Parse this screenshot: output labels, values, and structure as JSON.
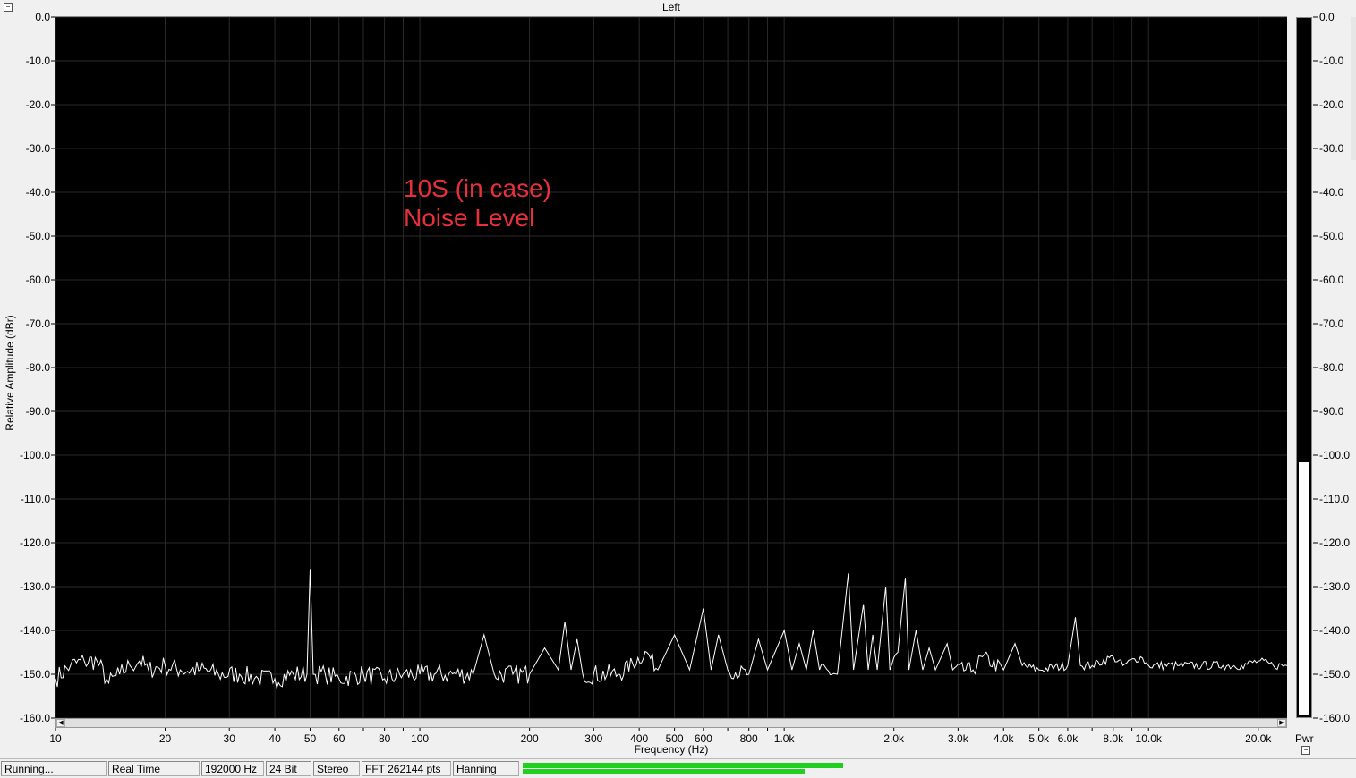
{
  "window": {
    "title": "Left"
  },
  "annotation": {
    "line1": "10S (in case)",
    "line2": "Noise Level"
  },
  "meter": {
    "label": "Pwr",
    "level_db": -102.0
  },
  "status": {
    "state": "Running...",
    "mode": "Real Time",
    "sample_rate": "192000 Hz",
    "bit_depth": "24 Bit",
    "channels": "Stereo",
    "fft": "FFT 262144 pts",
    "window": "Hanning",
    "progress_fraction": 0.56
  },
  "colors": {
    "plot_bg": "#000000",
    "trace": "#ffffff",
    "grid": "#2a2a2a",
    "annotation": "#e8303a",
    "progress": "#20d020"
  },
  "chart_data": {
    "type": "line",
    "xlabel": "Frequency (Hz)",
    "ylabel": "Relative Amplitude (dBr)",
    "xscale": "log",
    "xlim": [
      10,
      24000
    ],
    "ylim": [
      -160,
      0
    ],
    "x_ticks": [
      {
        "v": 10,
        "label": "10"
      },
      {
        "v": 20,
        "label": "20"
      },
      {
        "v": 30,
        "label": "30"
      },
      {
        "v": 40,
        "label": "40"
      },
      {
        "v": 50,
        "label": "50"
      },
      {
        "v": 60,
        "label": "60"
      },
      {
        "v": 80,
        "label": "80"
      },
      {
        "v": 100,
        "label": "100"
      },
      {
        "v": 200,
        "label": "200"
      },
      {
        "v": 300,
        "label": "300"
      },
      {
        "v": 400,
        "label": "400"
      },
      {
        "v": 500,
        "label": "500"
      },
      {
        "v": 600,
        "label": "600"
      },
      {
        "v": 800,
        "label": "800"
      },
      {
        "v": 1000,
        "label": "1.0k"
      },
      {
        "v": 2000,
        "label": "2.0k"
      },
      {
        "v": 3000,
        "label": "3.0k"
      },
      {
        "v": 4000,
        "label": "4.0k"
      },
      {
        "v": 5000,
        "label": "5.0k"
      },
      {
        "v": 6000,
        "label": "6.0k"
      },
      {
        "v": 8000,
        "label": "8.0k"
      },
      {
        "v": 10000,
        "label": "10.0k"
      },
      {
        "v": 20000,
        "label": "20.0k"
      }
    ],
    "y_ticks": [
      "0.0",
      "-10.0",
      "-20.0",
      "-30.0",
      "-40.0",
      "-50.0",
      "-60.0",
      "-70.0",
      "-80.0",
      "-90.0",
      "-100.0",
      "-110.0",
      "-120.0",
      "-130.0",
      "-140.0",
      "-150.0",
      "-160.0"
    ],
    "meter_ticks": [
      "0.0",
      "-10.0",
      "-20.0",
      "-30.0",
      "-40.0",
      "-50.0",
      "-60.0",
      "-70.0",
      "-80.0",
      "-90.0",
      "-100.0",
      "-110.0",
      "-120.0",
      "-130.0",
      "-140.0",
      "-150.0",
      "-160.0"
    ],
    "noise_floor_db": -150,
    "series": [
      {
        "points": [
          [
            10,
            -151
          ],
          [
            11,
            -148
          ],
          [
            12,
            -147
          ],
          [
            13,
            -147
          ],
          [
            14,
            -152
          ],
          [
            15,
            -150
          ],
          [
            16,
            -148
          ],
          [
            17,
            -147
          ],
          [
            18,
            -149
          ],
          [
            20,
            -148
          ],
          [
            22,
            -149
          ],
          [
            25,
            -149
          ],
          [
            28,
            -150
          ],
          [
            32,
            -150
          ],
          [
            36,
            -151
          ],
          [
            40,
            -151
          ],
          [
            45,
            -150
          ],
          [
            49,
            -150
          ],
          [
            50,
            -126
          ],
          [
            51,
            -150
          ],
          [
            55,
            -150
          ],
          [
            60,
            -151
          ],
          [
            70,
            -150
          ],
          [
            80,
            -151
          ],
          [
            90,
            -150
          ],
          [
            100,
            -150
          ],
          [
            120,
            -150
          ],
          [
            140,
            -150
          ],
          [
            150,
            -141
          ],
          [
            160,
            -150
          ],
          [
            180,
            -150
          ],
          [
            200,
            -150
          ],
          [
            220,
            -144
          ],
          [
            240,
            -149
          ],
          [
            250,
            -138
          ],
          [
            260,
            -149
          ],
          [
            270,
            -142
          ],
          [
            280,
            -150
          ],
          [
            350,
            -150
          ],
          [
            420,
            -145
          ],
          [
            450,
            -149
          ],
          [
            500,
            -141
          ],
          [
            550,
            -149
          ],
          [
            600,
            -135
          ],
          [
            630,
            -149
          ],
          [
            660,
            -141
          ],
          [
            700,
            -149
          ],
          [
            800,
            -150
          ],
          [
            850,
            -142
          ],
          [
            900,
            -149
          ],
          [
            1000,
            -140
          ],
          [
            1050,
            -149
          ],
          [
            1100,
            -143
          ],
          [
            1150,
            -149
          ],
          [
            1200,
            -140
          ],
          [
            1250,
            -149
          ],
          [
            1400,
            -150
          ],
          [
            1500,
            -127
          ],
          [
            1550,
            -149
          ],
          [
            1650,
            -134
          ],
          [
            1700,
            -149
          ],
          [
            1750,
            -141
          ],
          [
            1800,
            -149
          ],
          [
            1900,
            -130
          ],
          [
            1950,
            -149
          ],
          [
            2050,
            -145
          ],
          [
            2150,
            -128
          ],
          [
            2200,
            -149
          ],
          [
            2300,
            -140
          ],
          [
            2400,
            -149
          ],
          [
            2500,
            -144
          ],
          [
            2600,
            -149
          ],
          [
            2800,
            -143
          ],
          [
            2900,
            -149
          ],
          [
            3300,
            -149
          ],
          [
            3500,
            -146
          ],
          [
            4000,
            -149
          ],
          [
            4300,
            -143
          ],
          [
            4500,
            -148
          ],
          [
            5000,
            -149
          ],
          [
            6000,
            -148
          ],
          [
            6300,
            -137
          ],
          [
            6500,
            -148
          ],
          [
            7000,
            -148
          ],
          [
            8000,
            -146
          ],
          [
            8500,
            -148
          ],
          [
            9500,
            -146
          ],
          [
            10000,
            -148
          ],
          [
            12000,
            -148
          ],
          [
            14000,
            -148
          ],
          [
            16000,
            -148
          ],
          [
            18000,
            -148
          ],
          [
            20000,
            -147
          ],
          [
            22000,
            -148
          ],
          [
            24000,
            -148
          ]
        ]
      }
    ]
  }
}
